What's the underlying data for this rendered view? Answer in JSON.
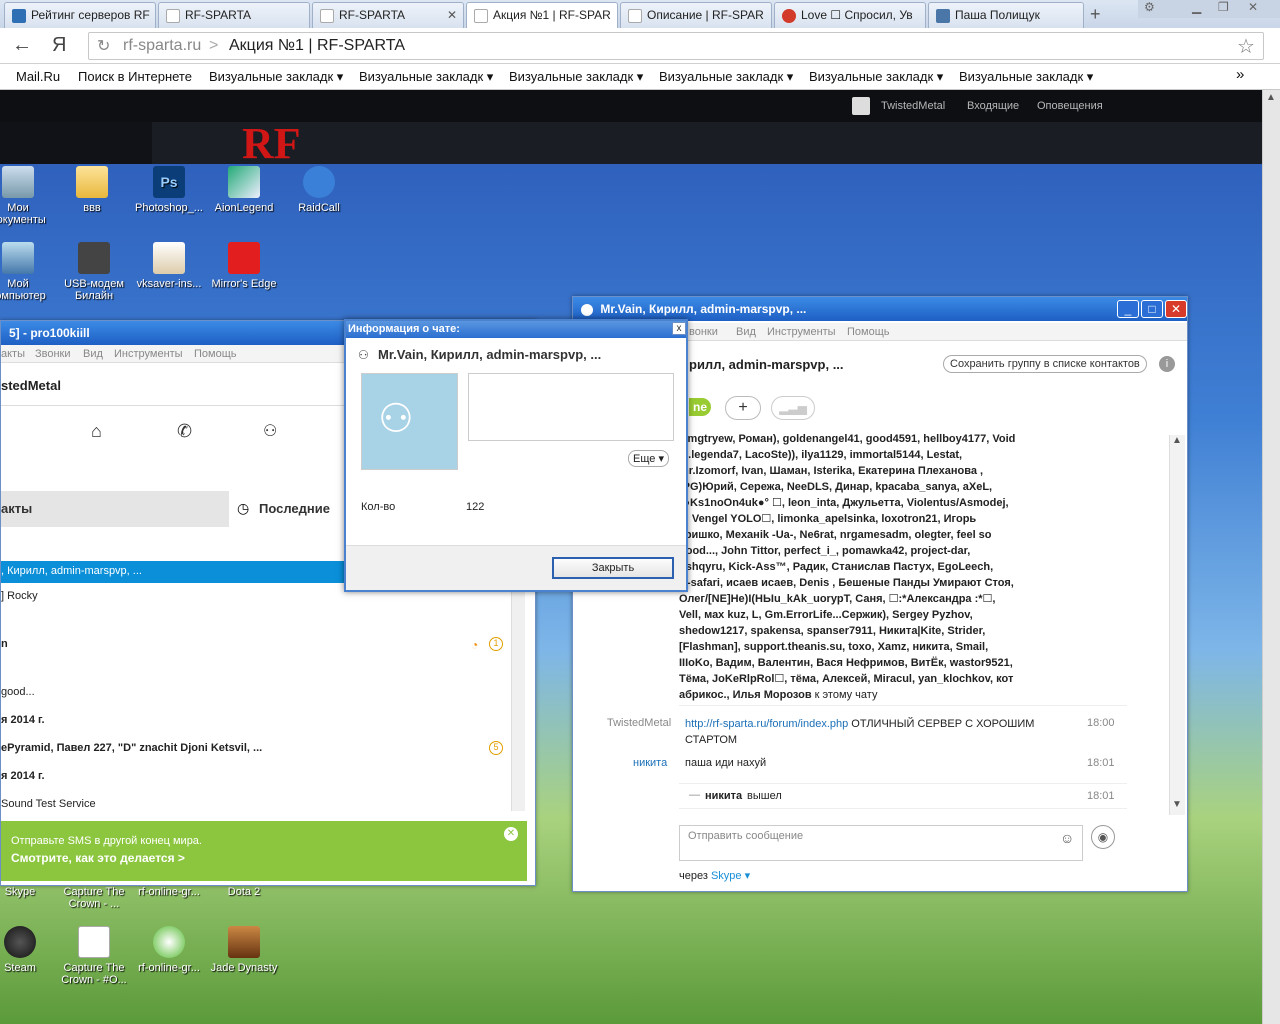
{
  "tabs": [
    {
      "label": "Рейтинг серверов RF",
      "color": "#2f6fb4"
    },
    {
      "label": "RF-SPARTA",
      "color": "#c0c0c0"
    },
    {
      "label": "RF-SPARTA",
      "color": "#c0c0c0"
    },
    {
      "label": "Акция №1 | RF-SPAR",
      "color": "#c0c0c0"
    },
    {
      "label": "Описание | RF-SPAR",
      "color": "#c0c0c0"
    },
    {
      "label": "Love ☐ Спросил, Ув",
      "color": "#d23a2a"
    },
    {
      "label": "Паша Полищук",
      "color": "#4a76a8"
    }
  ],
  "address": {
    "domain": "rf-sparta.ru",
    "sep": ">",
    "title": "Акция №1 | RF-SPARTA",
    "back": "←",
    "yandex": "Я",
    "reload": "↻",
    "star": "☆"
  },
  "bookmarks": [
    "Mail.Ru",
    "Поиск в Интернете",
    "Визуальные закладк ▾",
    "Визуальные закладк ▾",
    "Визуальные закладк ▾",
    "Визуальные закладк ▾",
    "Визуальные закладк ▾",
    "Визуальные закладк ▾"
  ],
  "bookmarks_more": "»",
  "site": {
    "user": "TwistedMetal",
    "inbox": "Входящие",
    "alerts": "Оповещения",
    "logo": "RF"
  },
  "desktop": [
    {
      "label": "Мои документы"
    },
    {
      "label": "ввв"
    },
    {
      "label": "Photoshop_..."
    },
    {
      "label": "AionLegend"
    },
    {
      "label": "RaidCall"
    },
    {
      "label": "Мой компьютер"
    },
    {
      "label": "USB-модем Билайн"
    },
    {
      "label": "vksaver-ins..."
    },
    {
      "label": "Mirror's Edge"
    },
    {
      "label": "Skype"
    },
    {
      "label": "Capture The Crown - ..."
    },
    {
      "label": "rf-online-gr..."
    },
    {
      "label": "Dota 2"
    },
    {
      "label": "Steam"
    },
    {
      "label": "Capture The Crown - #O..."
    },
    {
      "label": "rf-online-gr..."
    },
    {
      "label": "Jade Dynasty"
    }
  ],
  "skype_left": {
    "title": "5] - pro100kiill",
    "menu": [
      "акты",
      "Звонки",
      "Вид",
      "Инструменты",
      "Помощь"
    ],
    "user": "stedMetal",
    "tab_contacts": "акты",
    "tab_recent": "Последние",
    "rows": [
      {
        "text": ", Кирилл, admin-marspvp, ..."
      },
      {
        "text": "] Rocky"
      },
      {
        "text": "n"
      },
      {
        "text": "good..."
      },
      {
        "text": "я 2014 г."
      },
      {
        "text": "ePyramid, Павел 227, \"D\" znachit Djoni Ketsvil, ..."
      },
      {
        "text": "я 2014 г."
      },
      {
        "text": "Sound Test Service"
      }
    ],
    "badge1": "1",
    "badge2": "5",
    "promo_line1": "Отправьте SMS в другой конец мира.",
    "promo_line2": "Смотрите, как это делается >"
  },
  "dialog": {
    "title": "Информация о чате:",
    "group": "Mr.Vain, Кирилл, admin-marspvp, ...",
    "more": "Еще ▾",
    "count_label": "Кол-во",
    "count_value": "122",
    "close": "Закрыть",
    "x": "x"
  },
  "skype_chat": {
    "title": "Mr.Vain, Кирилл, admin-marspvp, ...",
    "menu": [
      "вонки",
      "Вид",
      "Инструменты",
      "Помощь"
    ],
    "header": "рилл, admin-marspvp, ...",
    "save_group": "Сохранить группу в списке контактов",
    "online": "ne",
    "members_text": [
      "Omgtryew, Роман), goldenangel41, good4591, hellboy4177, Void",
      ", i.legenda7, LacoSte)), ilya1129, immortal5144, Lestat,",
      "mr.Izomorf, Ivan, Шаман, Isterika, Екатерина Плеханова ,",
      "(PG)Юрий, Сережа, NeeDLS, Динар, kpacaba_sanya, aXeL,",
      "°●Ks1noOn4uk●° ☐, leon_inta, Джульетта, Violentus/Asmodej,",
      "☐ Vengel  YOLO☐, limonka_apelsinka, loxotron21, Игорь",
      "Гришко, Mexaнik -Ua-, Ne6rat, nrgamesadm, olegter, feel so",
      "good..., John Tittor, perfect_i_, pomawka42, project-dar,",
      "qshqyru, Kick-Ass™, Радик, Станислав Пастух, EgoLeech,",
      "rf-safari, исаев исаев, Denis , Бешеные Панды Умирают Стоя,",
      "Олег/[NE]Не)I(НЬIu_kAk_uorypT, Саня, ☐:*Александра :*☐,",
      "Vell, мах kuz, L, Gm.ErrorLife...Сержик), Sergey Pyzhov,",
      "shedow1217, spakensa, spanser7911, Никита|Kite, Strider,",
      "[Flashman], support.theanis.su, toxo, Xamz, никита, Smail,",
      "IIIoKo, Вадим, Валентин, Вася Нефримов, ВитЁк, wastor9521,",
      "Тёма, JoKeRlpRol☐, тёма, Алексей, Miracul, yan_klochkov, кот",
      "абрикос., Илья Морозов"
    ],
    "members_suffix": " к этому чату",
    "msg1_author": "TwistedMetal",
    "msg1_link": "http://rf-sparta.ru/forum/index.php",
    "msg1_text": " ОТЛИЧНЫЙ СЕРВЕР С ХОРОШИМ",
    "msg1_text2": "СТАРТОМ",
    "msg1_time": "18:00",
    "msg2_author": "никита",
    "msg2_text": "паша иди нахуй",
    "msg2_time": "18:01",
    "msg3_name": "никита",
    "msg3_text": " вышел",
    "msg3_time": "18:01",
    "input_placeholder": "Отправить сообщение",
    "via": "через ",
    "via_link": "Skype ▾"
  }
}
